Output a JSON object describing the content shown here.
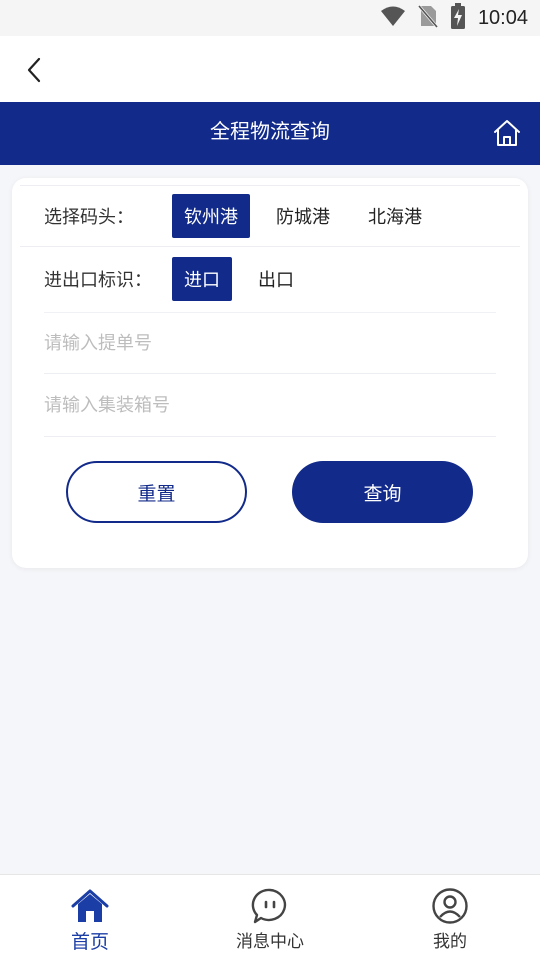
{
  "status_bar": {
    "time": "10:04"
  },
  "header": {
    "title": "全程物流查询"
  },
  "form": {
    "port_label": "选择码头：",
    "ports": [
      "钦州港",
      "防城港",
      "北海港"
    ],
    "selected_port": "钦州港",
    "io_label": "进出口标识：",
    "io_options": [
      "进口",
      "出口"
    ],
    "selected_io": "进口",
    "bill_placeholder": "请输入提单号",
    "container_placeholder": "请输入集装箱号",
    "reset_label": "重置",
    "query_label": "查询"
  },
  "bottom_nav": {
    "tabs": [
      {
        "label": "首页",
        "icon": "home-icon",
        "active": true
      },
      {
        "label": "消息中心",
        "icon": "message-icon",
        "active": false
      },
      {
        "label": "我的",
        "icon": "user-icon",
        "active": false
      }
    ]
  },
  "colors": {
    "primary": "#122a8a",
    "active_tab": "#1b3ea6",
    "background": "#f5f6f9"
  }
}
